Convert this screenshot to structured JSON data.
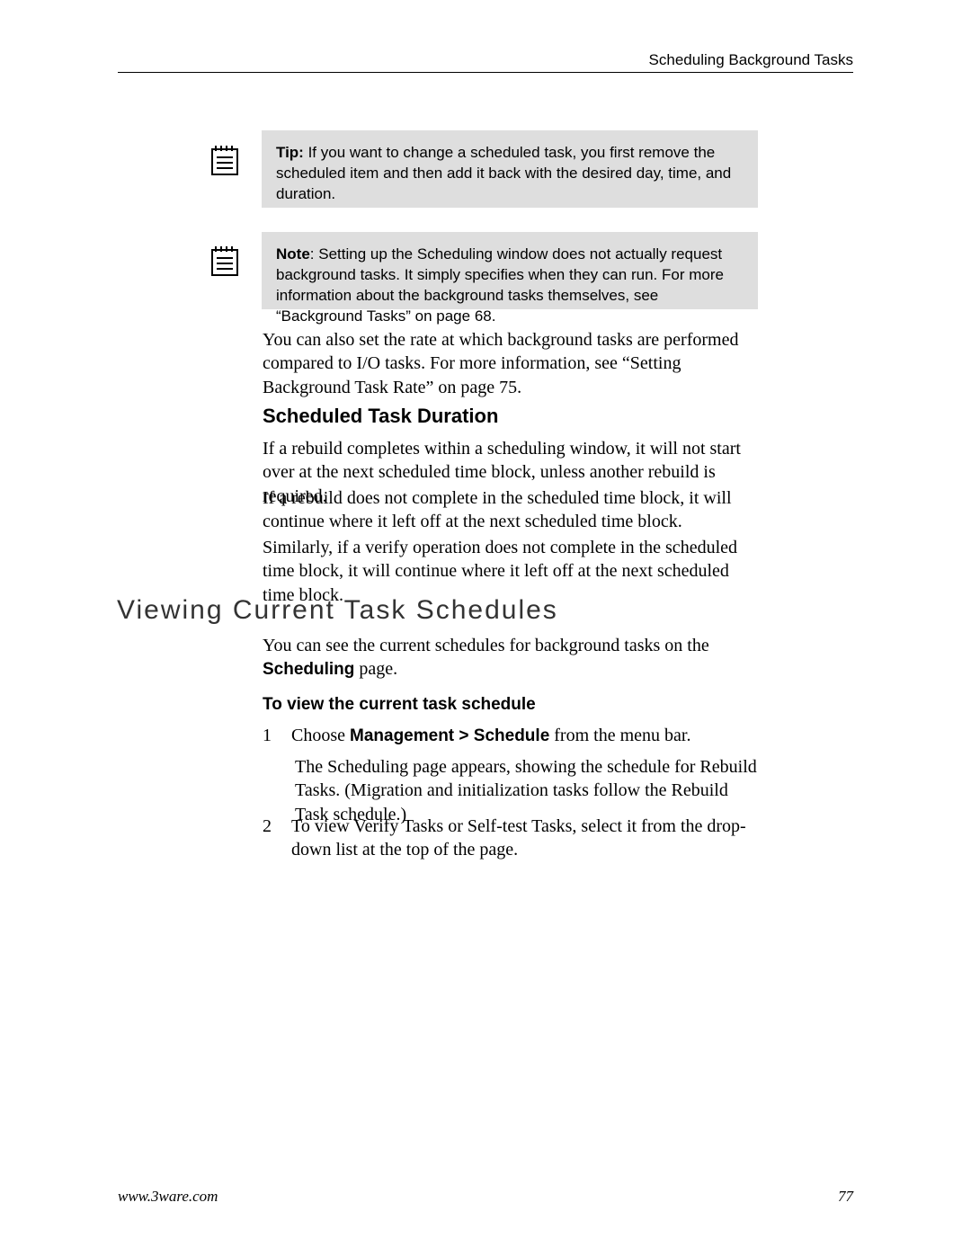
{
  "header": {
    "section_title": "Scheduling Background Tasks"
  },
  "callouts": {
    "tip": {
      "lead": "Tip:",
      "text": " If you want to change a scheduled task, you first remove the scheduled item and then add it back with the desired day, time, and duration."
    },
    "note": {
      "lead": "Note",
      "text": ": Setting up the Scheduling window does not actually request background tasks. It simply specifies when they can run. For more information about the background tasks themselves, see “Background Tasks” on page 68."
    }
  },
  "paragraphs": {
    "intro": "You can also set the rate at which background tasks are performed compared to I/O tasks. For more information, see “Setting Background Task Rate” on page 75.",
    "a": "If a rebuild completes within a scheduling window, it will not start over at the next scheduled time block, unless another rebuild is required.",
    "b": "If a rebuild does not complete in the scheduled time block, it will continue where it left off at the next scheduled time block.",
    "c": "Similarly, if a verify operation does not complete in the scheduled time block, it will continue where it left off at the next scheduled time block.",
    "d_pre": "You can see the current schedules for background tasks on the ",
    "d_bold": "Scheduling",
    "d_post": " page."
  },
  "headings": {
    "h3": "Scheduled Task Duration",
    "h2": "Viewing Current Task Schedules",
    "h4": "To view the current task schedule"
  },
  "steps": {
    "s1": {
      "num": "1",
      "pre": "Choose ",
      "bold": "Management > Schedule",
      "post": " from the menu bar.",
      "desc": "The Scheduling page appears, showing the schedule for Rebuild Tasks. (Migration and initialization tasks follow the Rebuild Task schedule.)"
    },
    "s2": {
      "num": "2",
      "text": "To view Verify Tasks or Self-test Tasks, select it from the drop-down list at the top of the page."
    }
  },
  "footer": {
    "url": "www.3ware.com",
    "page": "77"
  }
}
